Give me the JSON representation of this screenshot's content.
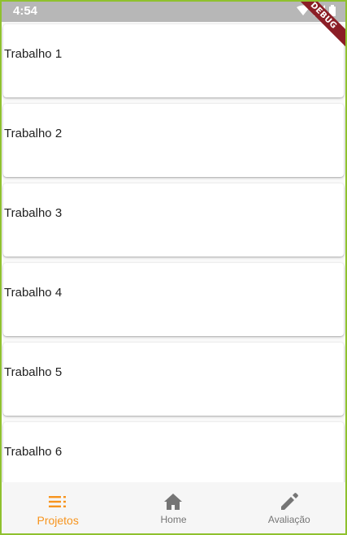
{
  "status_bar": {
    "time": "4:54",
    "icons": [
      "wifi-icon",
      "signal-icon",
      "battery-icon"
    ]
  },
  "debug_banner": "DEBUG",
  "cards": [
    {
      "label": "Trabalho 1"
    },
    {
      "label": "Trabalho 2"
    },
    {
      "label": "Trabalho 3"
    },
    {
      "label": "Trabalho 4"
    },
    {
      "label": "Trabalho 5"
    },
    {
      "label": "Trabalho 6"
    }
  ],
  "bottom_nav": {
    "items": [
      {
        "label": "Projetos",
        "icon": "list-icon",
        "active": true
      },
      {
        "label": "Home",
        "icon": "home-icon",
        "active": false
      },
      {
        "label": "Avaliação",
        "icon": "pencil-icon",
        "active": false
      }
    ]
  },
  "colors": {
    "accent": "#f7941d",
    "inactive": "#757575",
    "status_bar": "#b7b7b7",
    "frame": "#8fc12e"
  }
}
